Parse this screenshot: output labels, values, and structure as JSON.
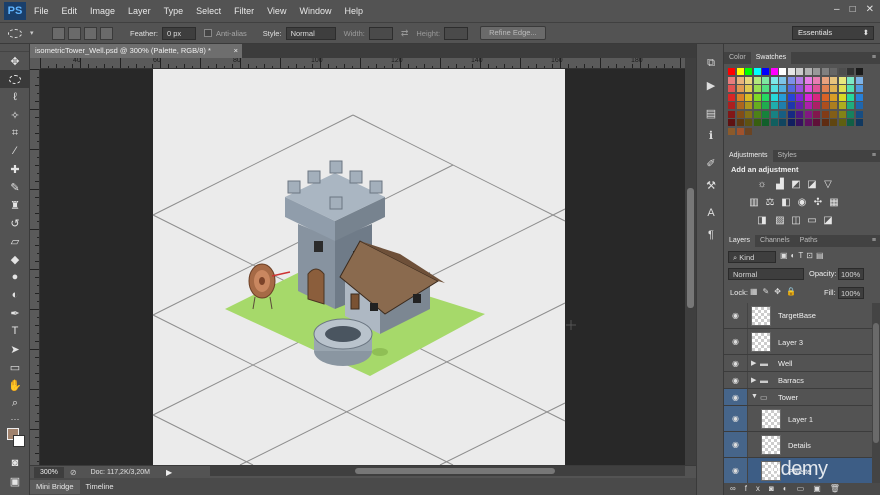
{
  "app": {
    "logo": "PS"
  },
  "menu": [
    "File",
    "Edit",
    "Image",
    "Layer",
    "Type",
    "Select",
    "Filter",
    "View",
    "Window",
    "Help"
  ],
  "window_controls": {
    "minimize": "–",
    "maximize": "□",
    "close": "✕"
  },
  "options_bar": {
    "feather_label": "Feather:",
    "feather_value": "0 px",
    "antialias_label": "Anti-alias",
    "style_label": "Style:",
    "style_value": "Normal",
    "width_label": "Width:",
    "height_label": "Height:",
    "refine_edge": "Refine Edge..."
  },
  "workspace": "Essentials",
  "document_tab": {
    "title": "isometricTower_Well.psd @ 300% (Palette, RGB/8) *",
    "close": "×"
  },
  "ruler": {
    "top_ticks": [
      "40",
      "60",
      "80",
      "100",
      "120",
      "140",
      "160",
      "180",
      "200",
      "220"
    ]
  },
  "status": {
    "zoom": "300%",
    "doc": "Doc: 117,2K/3,20M"
  },
  "bottom_tabs": [
    "Mini Bridge",
    "Timeline"
  ],
  "panels": {
    "color_tabs": [
      "Color",
      "Swatches"
    ],
    "adjust_tabs": [
      "Adjustments",
      "Styles"
    ],
    "adjust_title": "Add an adjustment",
    "layers_tabs": [
      "Layers",
      "Channels",
      "Paths"
    ],
    "kind_label": "Kind",
    "blend_mode": "Normal",
    "opacity_label": "Opacity:",
    "opacity_value": "100%",
    "lock_label": "Lock:",
    "fill_label": "Fill:",
    "fill_value": "100%",
    "layers": [
      {
        "name": "TargetBase",
        "type": "layer"
      },
      {
        "name": "Layer 3",
        "type": "layer"
      },
      {
        "name": "Well",
        "type": "group"
      },
      {
        "name": "Barracs",
        "type": "group"
      },
      {
        "name": "Tower",
        "type": "group-open"
      },
      {
        "name": "Layer 1",
        "type": "layer"
      },
      {
        "name": "Details",
        "type": "layer"
      },
      {
        "name": "Palette",
        "type": "layer"
      }
    ]
  },
  "watermark": "udemy"
}
